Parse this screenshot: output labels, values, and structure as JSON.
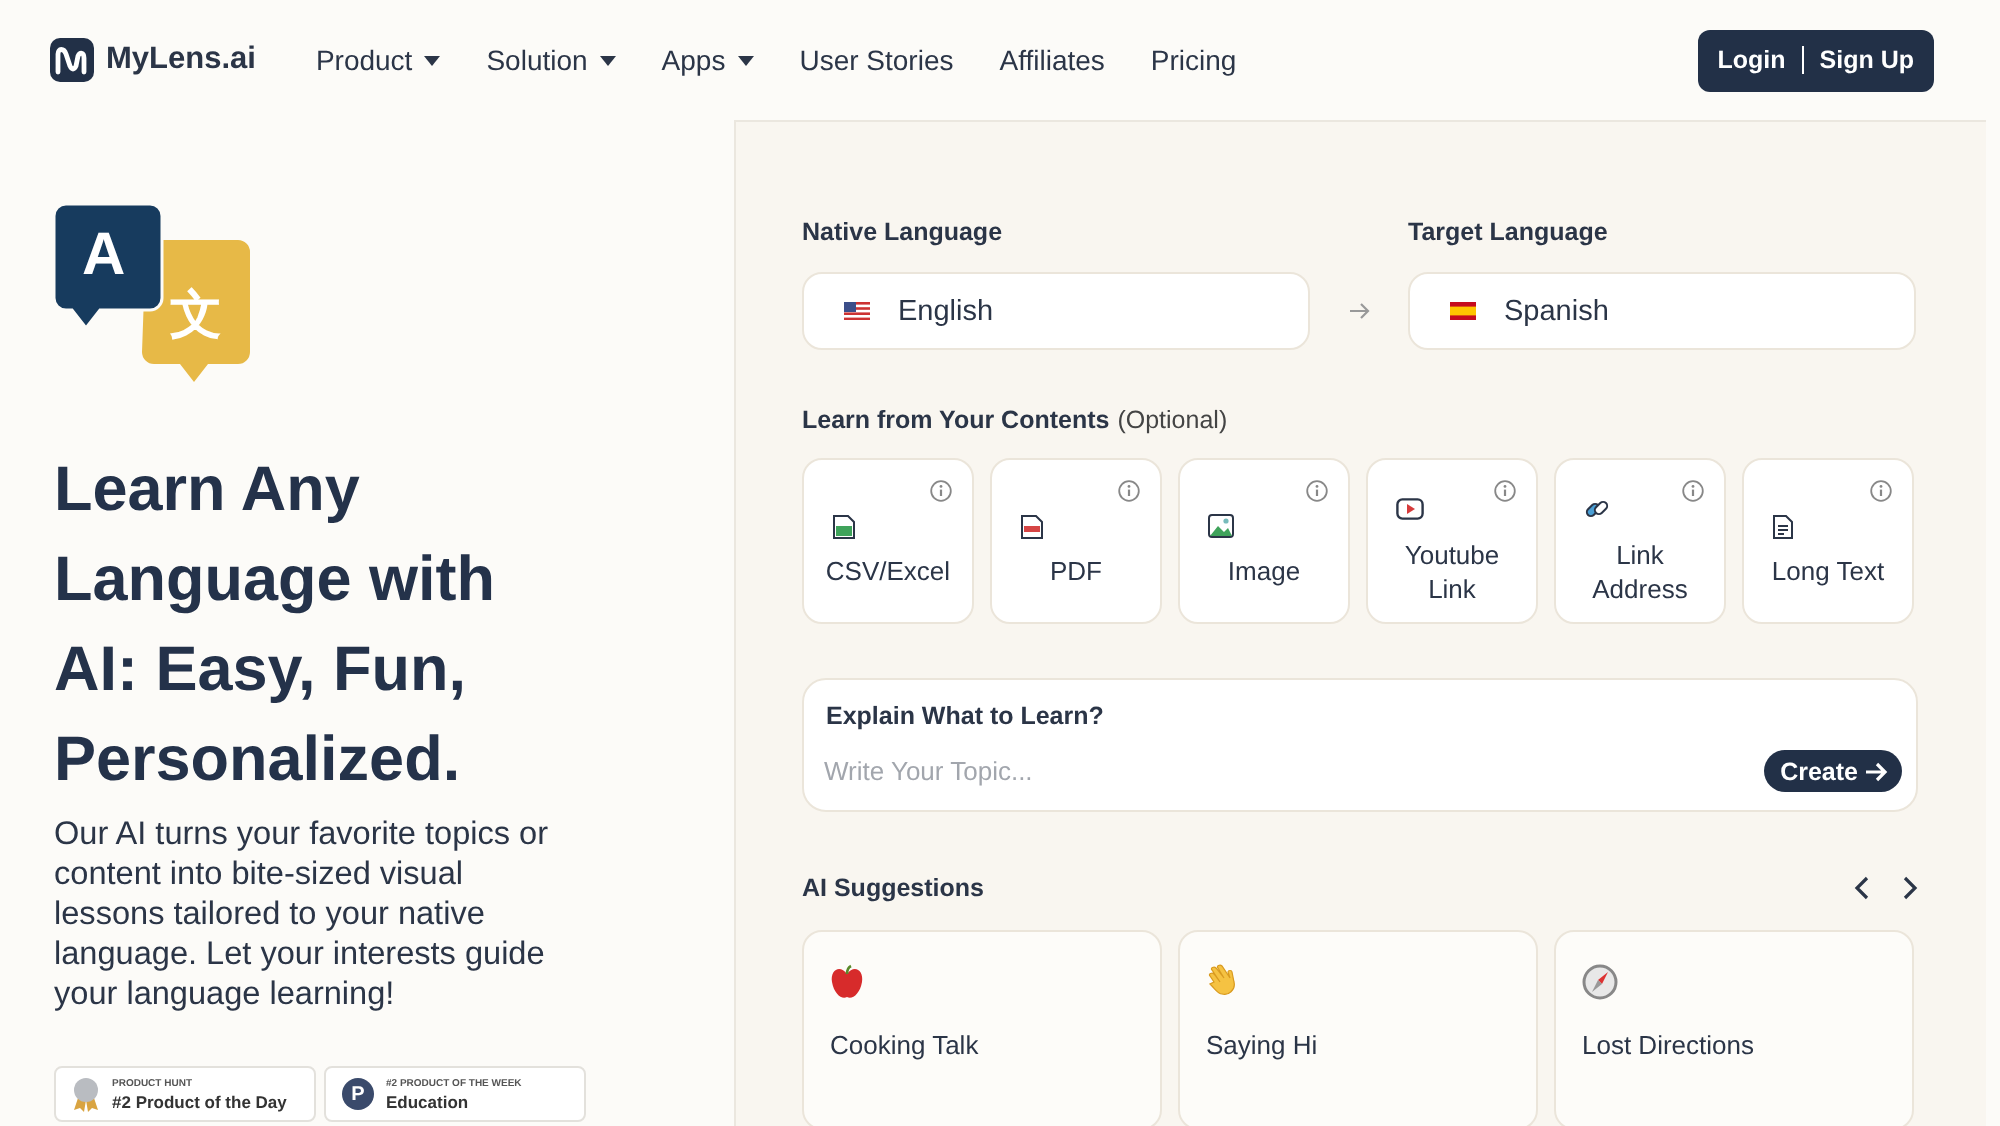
{
  "nav": {
    "brand": "MyLens.ai",
    "items": [
      {
        "label": "Product",
        "dropdown": true
      },
      {
        "label": "Solution",
        "dropdown": true
      },
      {
        "label": "Apps",
        "dropdown": true
      },
      {
        "label": "User Stories",
        "dropdown": false
      },
      {
        "label": "Affiliates",
        "dropdown": false
      },
      {
        "label": "Pricing",
        "dropdown": false
      }
    ],
    "login": "Login",
    "signup": "Sign Up"
  },
  "hero": {
    "icon_glyphs": [
      "A",
      "文"
    ],
    "title": "Learn Any Language with AI: Easy, Fun, Personalized.",
    "description": "Our AI turns your favorite topics or content into bite-sized visual lessons tailored to your native language. Let your interests guide your language learning!",
    "badges": [
      {
        "kind": "medal",
        "kicker": "PRODUCT HUNT",
        "title": "#2 Product of the Day"
      },
      {
        "kind": "letter",
        "letter": "P",
        "kicker": "#2 PRODUCT OF THE WEEK",
        "title": "Education"
      }
    ]
  },
  "form": {
    "native": {
      "label": "Native Language",
      "value": "English",
      "kind": "us"
    },
    "target": {
      "label": "Target Language",
      "value": "Spanish",
      "kind": "es"
    },
    "contents_title": "Learn from Your Contents",
    "contents_note": "(Optional)",
    "contents": [
      {
        "kind": "csv",
        "label": "CSV/Excel"
      },
      {
        "kind": "pdf",
        "label": "PDF"
      },
      {
        "kind": "image",
        "label": "Image"
      },
      {
        "kind": "youtube",
        "label": "Youtube Link"
      },
      {
        "kind": "link",
        "label": "Link Address"
      },
      {
        "kind": "text",
        "label": "Long Text"
      }
    ],
    "explain": {
      "title": "Explain What to Learn?",
      "placeholder": "Write Your Topic...",
      "button": "Create"
    },
    "suggestions_title": "AI Suggestions",
    "suggestions": [
      {
        "kind": "apple",
        "label": "Cooking Talk"
      },
      {
        "kind": "wave",
        "label": "Saying Hi"
      },
      {
        "kind": "compass",
        "label": "Lost Directions"
      }
    ]
  }
}
